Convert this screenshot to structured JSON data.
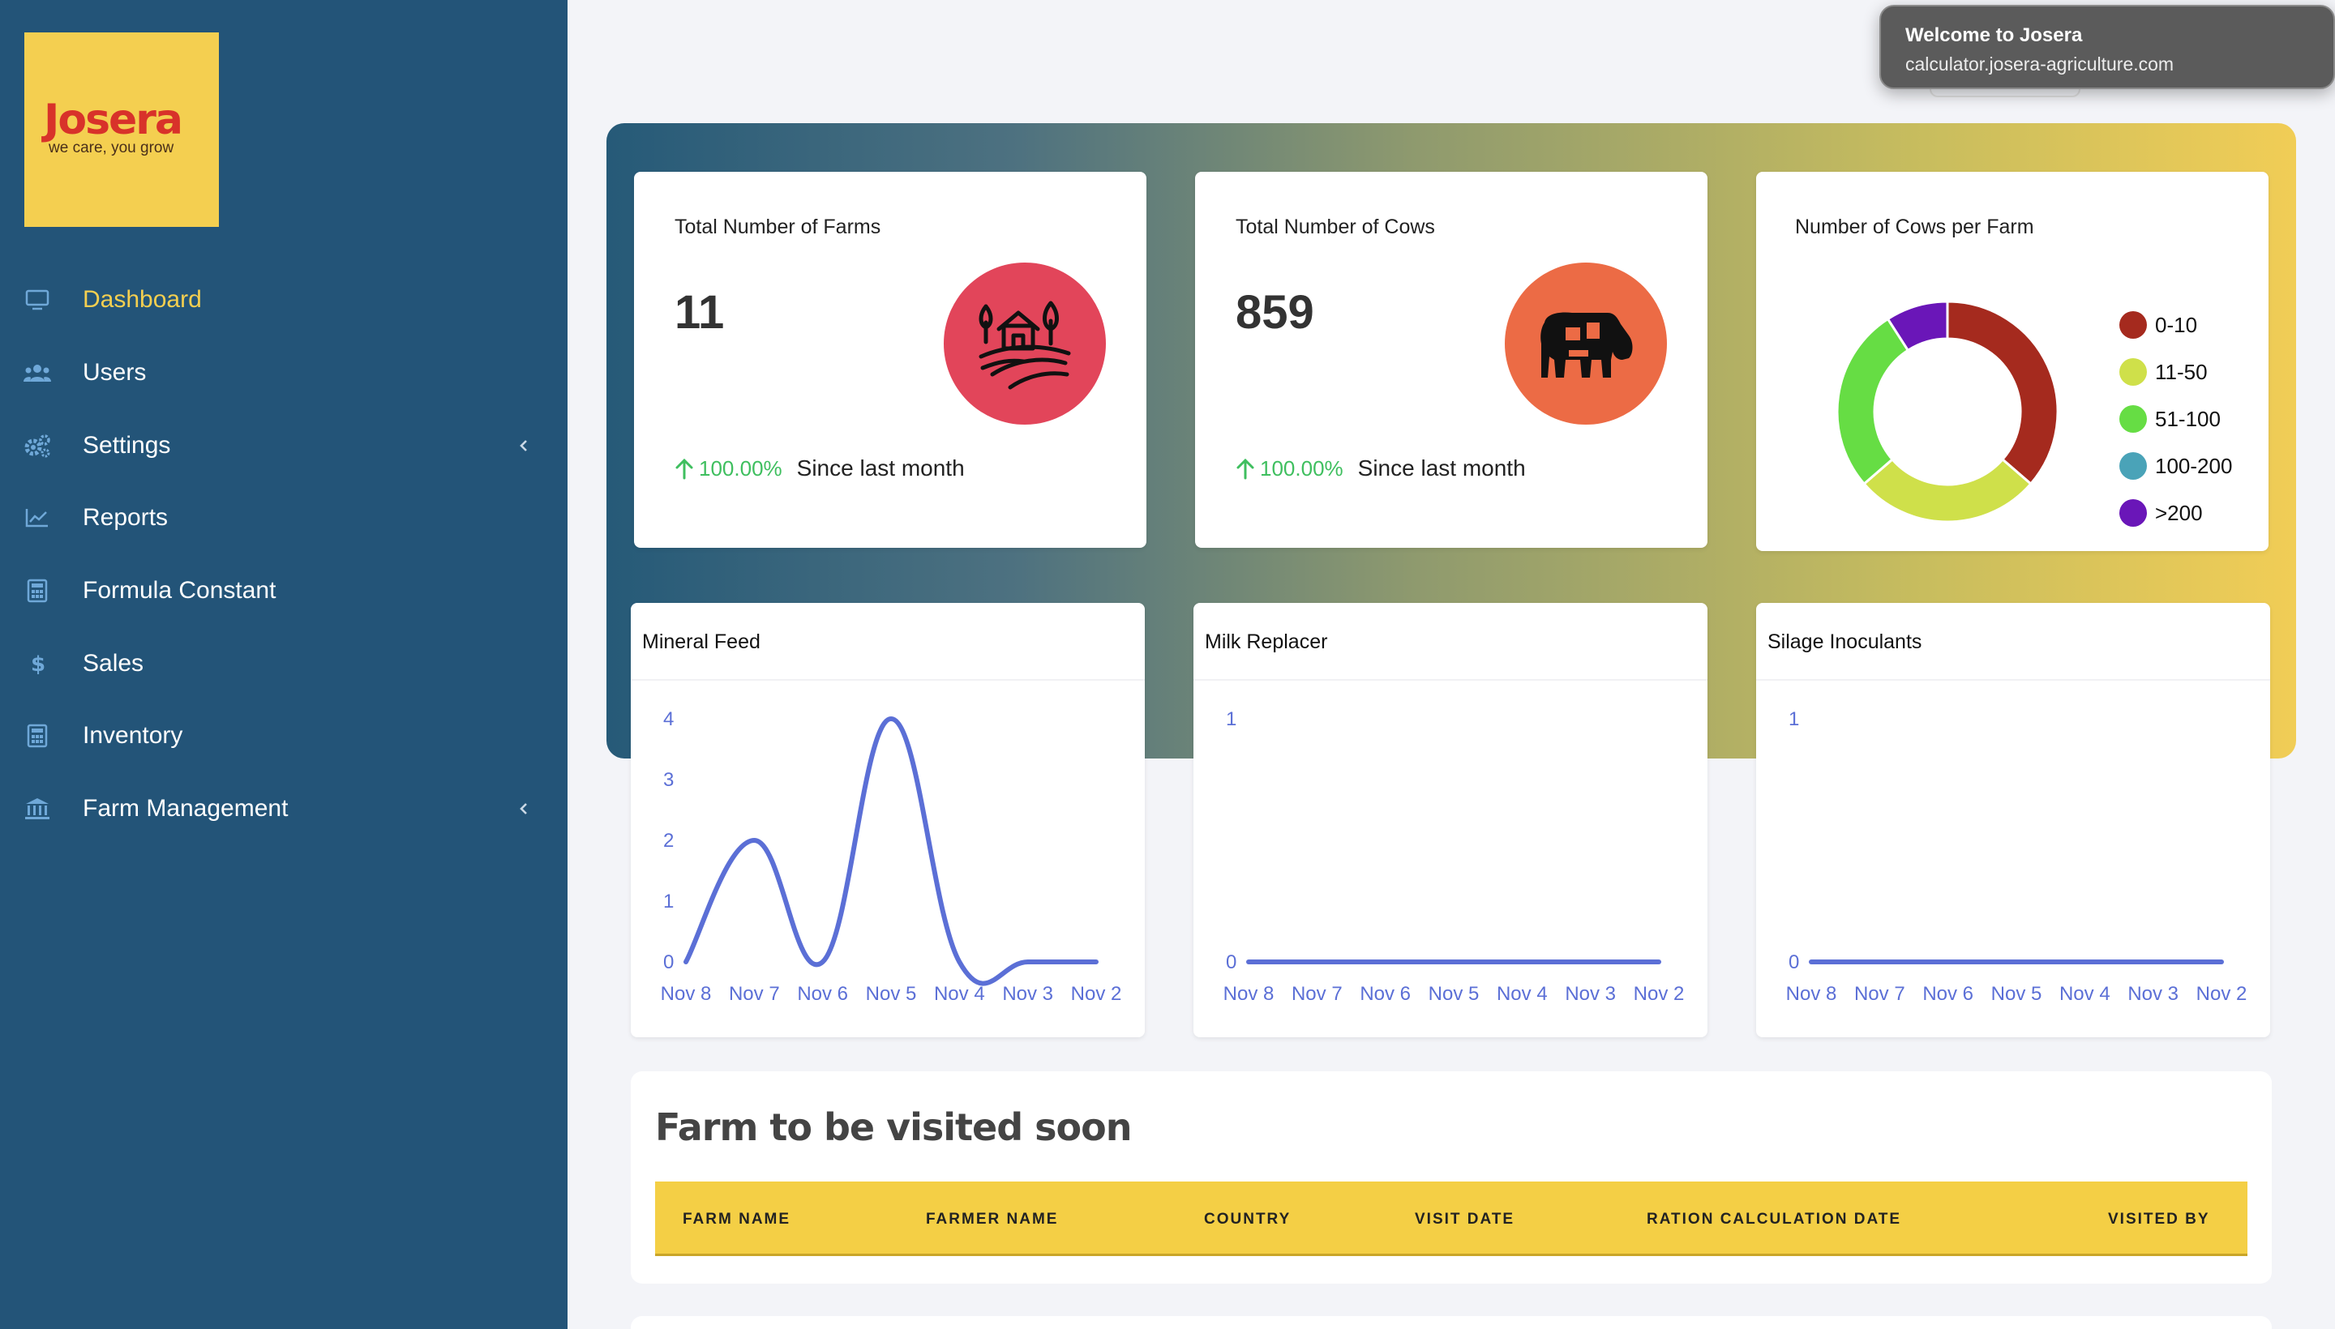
{
  "brand": {
    "name": "Josera",
    "tagline": "we care, you grow"
  },
  "sidebar": {
    "items": [
      {
        "label": "Dashboard",
        "icon": "monitor-icon",
        "active": true,
        "has_submenu": false
      },
      {
        "label": "Users",
        "icon": "users-icon",
        "active": false,
        "has_submenu": false
      },
      {
        "label": "Settings",
        "icon": "gears-icon",
        "active": false,
        "has_submenu": true
      },
      {
        "label": "Reports",
        "icon": "chart-line-icon",
        "active": false,
        "has_submenu": false
      },
      {
        "label": "Formula Constant",
        "icon": "calculator-icon",
        "active": false,
        "has_submenu": false
      },
      {
        "label": "Sales",
        "icon": "dollar-icon",
        "active": false,
        "has_submenu": false
      },
      {
        "label": "Inventory",
        "icon": "calculator-icon",
        "active": false,
        "has_submenu": false
      },
      {
        "label": "Farm Management",
        "icon": "bank-icon",
        "active": false,
        "has_submenu": true
      }
    ]
  },
  "toast": {
    "title": "Welcome to Josera",
    "subtitle": "calculator.josera-agriculture.com"
  },
  "stats": {
    "farms": {
      "title": "Total Number of Farms",
      "value": "11",
      "change": "100.00%",
      "since": "Since last month",
      "icon": "farm-icon",
      "color": "#e2455a"
    },
    "cows": {
      "title": "Total Number of Cows",
      "value": "859",
      "change": "100.00%",
      "since": "Since last month",
      "icon": "cow-icon",
      "color": "#ec6b45"
    }
  },
  "cows_per_farm": {
    "title": "Number of Cows per Farm",
    "legend": [
      {
        "label": "0-10",
        "color": "#a52a1e"
      },
      {
        "label": "11-50",
        "color": "#cfe04a"
      },
      {
        "label": "51-100",
        "color": "#66dd44"
      },
      {
        "label": "100-200",
        "color": "#4aa3b8"
      },
      {
        "label": ">200",
        "color": "#6a16b8"
      }
    ]
  },
  "chart_data": [
    {
      "type": "pie",
      "title": "Number of Cows per Farm",
      "categories": [
        "0-10",
        "11-50",
        "51-100",
        "100-200",
        ">200"
      ],
      "values": [
        4,
        3,
        3,
        0,
        1
      ]
    },
    {
      "type": "line",
      "title": "Mineral Feed",
      "categories": [
        "Nov 8",
        "Nov 7",
        "Nov 6",
        "Nov 5",
        "Nov 4",
        "Nov 3",
        "Nov 2"
      ],
      "series": [
        {
          "values": [
            0,
            2,
            0,
            4,
            0,
            0,
            0
          ]
        }
      ],
      "yticks": [
        "0",
        "1",
        "2",
        "3",
        "4"
      ],
      "ylim": [
        0,
        4
      ],
      "color": "#5b6fd6"
    },
    {
      "type": "line",
      "title": "Milk Replacer",
      "categories": [
        "Nov 8",
        "Nov 7",
        "Nov 6",
        "Nov 5",
        "Nov 4",
        "Nov 3",
        "Nov 2"
      ],
      "series": [
        {
          "values": [
            0,
            0,
            0,
            0,
            0,
            0,
            0
          ]
        }
      ],
      "yticks": [
        "0",
        "1"
      ],
      "ylim": [
        0,
        1
      ],
      "color": "#5b6fd6"
    },
    {
      "type": "line",
      "title": "Silage Inoculants",
      "categories": [
        "Nov 8",
        "Nov 7",
        "Nov 6",
        "Nov 5",
        "Nov 4",
        "Nov 3",
        "Nov 2"
      ],
      "series": [
        {
          "values": [
            0,
            0,
            0,
            0,
            0,
            0,
            0
          ]
        }
      ],
      "yticks": [
        "0",
        "1"
      ],
      "ylim": [
        0,
        1
      ],
      "color": "#5b6fd6"
    }
  ],
  "farm_visits": {
    "title": "Farm to be visited soon",
    "columns": [
      "FARM NAME",
      "FARMER NAME",
      "COUNTRY",
      "VISIT DATE",
      "RATION CALCULATION DATE",
      "VISITED BY"
    ]
  }
}
